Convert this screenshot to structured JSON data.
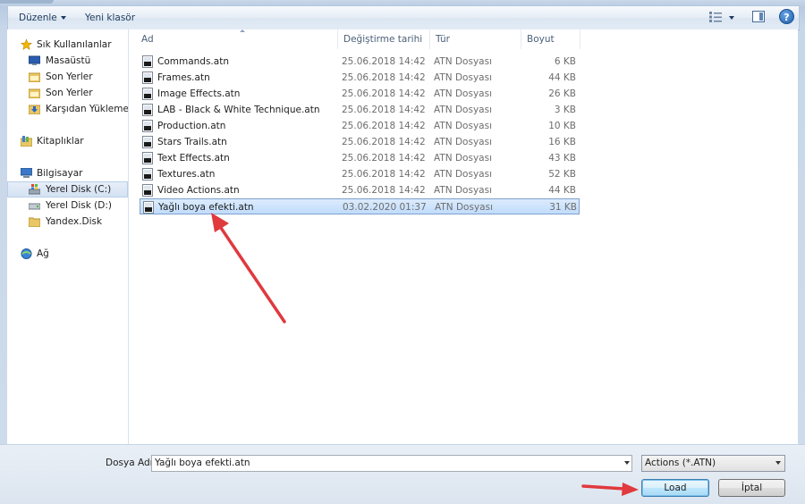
{
  "toolbar": {
    "organize_label": "Düzenle",
    "new_folder_label": "Yeni klasör",
    "views_icon": "views-icon",
    "preview_pane_icon": "preview-pane-icon",
    "help_icon": "help-icon",
    "help_glyph": "?"
  },
  "nav": {
    "favorites": {
      "label": "Sık Kullanılanlar",
      "items": [
        {
          "label": "Masaüstü",
          "icon": "desktop-icon"
        },
        {
          "label": "Son Yerler",
          "icon": "recent-places-icon"
        },
        {
          "label": "Son Yerler",
          "icon": "recent-places-icon"
        },
        {
          "label": "Karşıdan Yüklemeler",
          "icon": "downloads-icon"
        }
      ]
    },
    "libraries": {
      "label": "Kitaplıklar",
      "icon": "libraries-icon"
    },
    "computer": {
      "label": "Bilgisayar",
      "items": [
        {
          "label": "Yerel Disk (C:)",
          "icon": "windows-drive-icon",
          "selected": true
        },
        {
          "label": "Yerel Disk (D:)",
          "icon": "drive-icon"
        },
        {
          "label": "Yandex.Disk",
          "icon": "folder-icon"
        }
      ]
    },
    "network": {
      "label": "Ağ",
      "icon": "network-icon"
    }
  },
  "columns": {
    "name": "Ad",
    "date": "Değiştirme tarihi",
    "type": "Tür",
    "size": "Boyut"
  },
  "files": [
    {
      "name": "Commands.atn",
      "date": "25.06.2018 14:42",
      "type": "ATN Dosyası",
      "size": "6 KB"
    },
    {
      "name": "Frames.atn",
      "date": "25.06.2018 14:42",
      "type": "ATN Dosyası",
      "size": "44 KB"
    },
    {
      "name": "Image Effects.atn",
      "date": "25.06.2018 14:42",
      "type": "ATN Dosyası",
      "size": "26 KB"
    },
    {
      "name": "LAB - Black & White Technique.atn",
      "date": "25.06.2018 14:42",
      "type": "ATN Dosyası",
      "size": "3 KB"
    },
    {
      "name": "Production.atn",
      "date": "25.06.2018 14:42",
      "type": "ATN Dosyası",
      "size": "10 KB"
    },
    {
      "name": "Stars Trails.atn",
      "date": "25.06.2018 14:42",
      "type": "ATN Dosyası",
      "size": "16 KB"
    },
    {
      "name": "Text Effects.atn",
      "date": "25.06.2018 14:42",
      "type": "ATN Dosyası",
      "size": "43 KB"
    },
    {
      "name": "Textures.atn",
      "date": "25.06.2018 14:42",
      "type": "ATN Dosyası",
      "size": "52 KB"
    },
    {
      "name": "Video Actions.atn",
      "date": "25.06.2018 14:42",
      "type": "ATN Dosyası",
      "size": "44 KB"
    },
    {
      "name": "Yağlı boya efekti.atn",
      "date": "03.02.2020 01:37",
      "type": "ATN Dosyası",
      "size": "31 KB",
      "selected": true
    }
  ],
  "footer": {
    "filename_label": "Dosya Adı:",
    "filename_value": "Yağlı boya efekti.atn",
    "filter_value": "Actions (*.ATN)",
    "load_label": "Load",
    "cancel_label": "İptal"
  },
  "colors": {
    "annotation_arrow": "#e0393e",
    "selection": "#cce4fc"
  }
}
